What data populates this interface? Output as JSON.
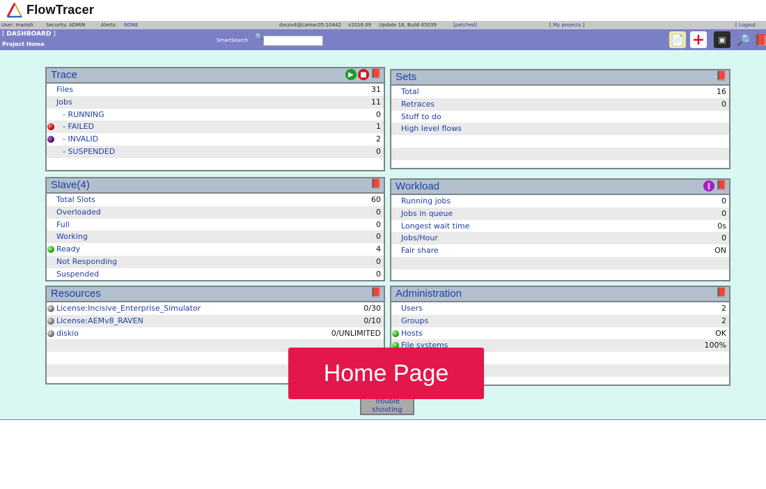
{
  "app": {
    "name": "FlowTracer"
  },
  "infobar": {
    "user": "User: manish",
    "security": "Security: ADMIN",
    "alerts_label": "Alerts:",
    "alerts_value": "NONE",
    "server": "dvcov4@camac05:10442",
    "version": "v2016.09",
    "update": "Update 16, Build 65039",
    "patched": "[patched]",
    "my_projects": "My projects",
    "logout": "Logout"
  },
  "nav": {
    "dashboard": "DASHBOARD",
    "project_home": "Project Home",
    "smartsearch_label": "SmartSearch",
    "smartsearch_value": ""
  },
  "panels": {
    "trace": {
      "title": "Trace",
      "rows": [
        {
          "label": "Files",
          "value": "31"
        },
        {
          "label": "Jobs",
          "value": "11"
        },
        {
          "label": "- RUNNING",
          "value": "0"
        },
        {
          "label": "- FAILED",
          "value": "1"
        },
        {
          "label": "- INVALID",
          "value": "2"
        },
        {
          "label": "- SUSPENDED",
          "value": "0"
        }
      ]
    },
    "sets": {
      "title": "Sets",
      "rows": [
        {
          "label": "Total",
          "value": "16"
        },
        {
          "label": "Retraces",
          "value": "0"
        },
        {
          "label": "Stuff to do",
          "value": ""
        },
        {
          "label": "High level flows",
          "value": ""
        }
      ]
    },
    "slave": {
      "title": "Slave(4)",
      "rows": [
        {
          "label": "Total Slots",
          "value": "60"
        },
        {
          "label": "Overloaded",
          "value": "0"
        },
        {
          "label": "Full",
          "value": "0"
        },
        {
          "label": "Working",
          "value": "0"
        },
        {
          "label": "Ready",
          "value": "4"
        },
        {
          "label": "Not Responding",
          "value": "0"
        },
        {
          "label": "Suspended",
          "value": "0"
        }
      ]
    },
    "workload": {
      "title": "Workload",
      "rows": [
        {
          "label": "Running jobs",
          "value": "0"
        },
        {
          "label": "Jobs in queue",
          "value": "0"
        },
        {
          "label": "Longest wait time",
          "value": "0s"
        },
        {
          "label": "Jobs/Hour",
          "value": "0"
        },
        {
          "label": "Fair share",
          "value": "ON"
        }
      ]
    },
    "resources": {
      "title": "Resources",
      "rows": [
        {
          "label": "License:Incisive_Enterprise_Simulator",
          "value": "0/30"
        },
        {
          "label": "License:AEMv8_RAVEN",
          "value": "0/10"
        },
        {
          "label": "diskio",
          "value": "0/UNLIMITED"
        }
      ]
    },
    "administration": {
      "title": "Administration",
      "rows": [
        {
          "label": "Users",
          "value": "2"
        },
        {
          "label": "Groups",
          "value": "2"
        },
        {
          "label": "Hosts",
          "value": "OK"
        },
        {
          "label": "File systems",
          "value": "100%"
        }
      ]
    }
  },
  "trouble_button": "Trouble shooting",
  "overlay_banner": "Home Page",
  "colors": {
    "accent_nav": "#7b80c6",
    "background": "#d9f7f3",
    "link_blue": "#1d3fa3",
    "overlay_red": "#e3174a"
  }
}
